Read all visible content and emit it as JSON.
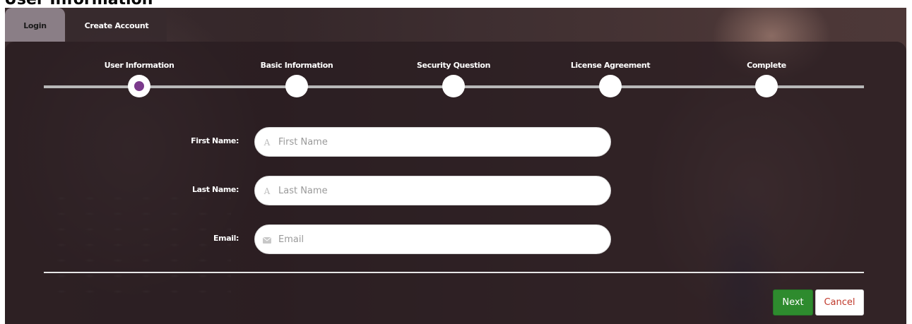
{
  "page": {
    "heading": "User Information"
  },
  "tabs": [
    {
      "label": "Login",
      "active": false
    },
    {
      "label": "Create Account",
      "active": true
    }
  ],
  "steps": [
    {
      "label": "User Information",
      "state": "current"
    },
    {
      "label": "Basic Information",
      "state": "pending"
    },
    {
      "label": "Security Question",
      "state": "pending"
    },
    {
      "label": "License Agreement",
      "state": "pending"
    },
    {
      "label": "Complete",
      "state": "pending"
    }
  ],
  "form": {
    "first_name": {
      "label": "First Name:",
      "placeholder": "First Name",
      "value": "",
      "icon": "text-a-icon"
    },
    "last_name": {
      "label": "Last Name:",
      "placeholder": "Last Name",
      "value": "",
      "icon": "text-a-icon"
    },
    "email": {
      "label": "Email:",
      "placeholder": "Email",
      "value": "",
      "icon": "envelope-icon"
    }
  },
  "actions": {
    "next_label": "Next",
    "cancel_label": "Cancel"
  },
  "colors": {
    "accent_step": "#7b3a8c",
    "next_button": "#2e8b2e",
    "cancel_text": "#c0392b"
  }
}
